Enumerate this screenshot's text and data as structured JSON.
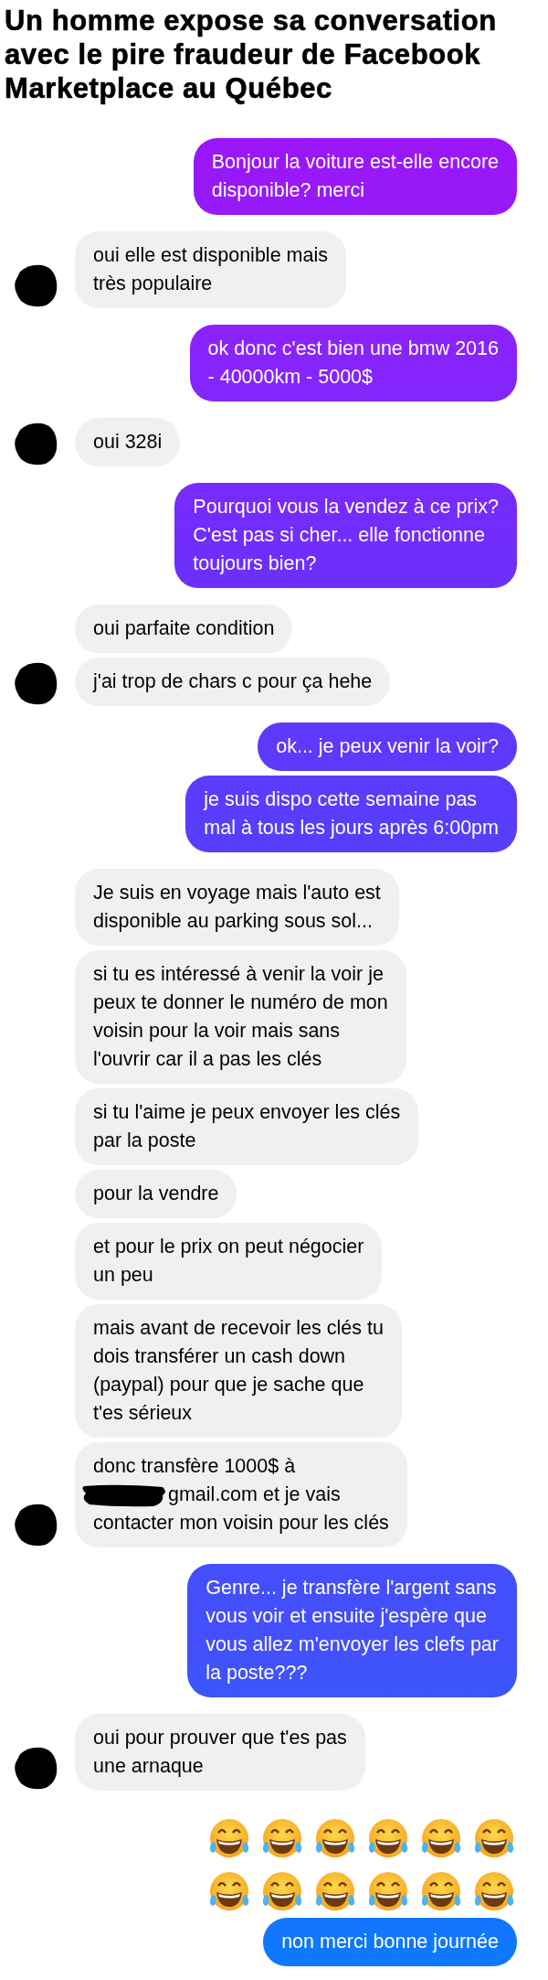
{
  "title": "Un homme expose sa conversation avec le pire fraudeur de Facebook Marketplace au Québec",
  "messages": [
    {
      "kind": "text",
      "outgoing": true,
      "lines": [
        "Bonjour la voiture est-elle encore",
        "disponible? merci"
      ]
    },
    {
      "kind": "text",
      "outgoing": false,
      "avatar": true,
      "lines": [
        "oui elle est disponible mais",
        "très populaire"
      ]
    },
    {
      "kind": "text",
      "outgoing": true,
      "lines": [
        "ok donc c'est bien une bmw 2016",
        "- 40000km - 5000$"
      ]
    },
    {
      "kind": "text",
      "outgoing": false,
      "avatar": true,
      "lines": [
        "oui 328i"
      ]
    },
    {
      "kind": "text",
      "outgoing": true,
      "lines": [
        "Pourquoi vous la vendez à ce prix?",
        "C'est pas si cher... elle fonctionne",
        "toujours bien?"
      ]
    },
    {
      "kind": "text",
      "outgoing": false,
      "avatar": false,
      "lines": [
        "oui parfaite condition"
      ]
    },
    {
      "kind": "text",
      "outgoing": false,
      "avatar": true,
      "lines": [
        "j'ai trop de chars c pour ça hehe"
      ]
    },
    {
      "kind": "text",
      "outgoing": true,
      "lines": [
        "ok... je peux venir la voir?"
      ]
    },
    {
      "kind": "text",
      "outgoing": true,
      "lines": [
        "je suis dispo cette semaine pas",
        "mal à tous les jours après 6:00pm"
      ]
    },
    {
      "kind": "text",
      "outgoing": false,
      "avatar": false,
      "lines": [
        "Je suis en voyage mais l'auto est",
        "disponible au parking sous sol..."
      ]
    },
    {
      "kind": "text",
      "outgoing": false,
      "avatar": false,
      "lines": [
        "si tu es intéressé à venir la voir je",
        "peux te donner le numéro de mon",
        "voisin pour la voir mais sans",
        "l'ouvrir car il a pas les clés"
      ]
    },
    {
      "kind": "text",
      "outgoing": false,
      "avatar": false,
      "lines": [
        "si tu l'aime je peux envoyer les clés",
        "par la poste"
      ]
    },
    {
      "kind": "text",
      "outgoing": false,
      "avatar": false,
      "lines": [
        "pour la vendre"
      ]
    },
    {
      "kind": "text",
      "outgoing": false,
      "avatar": false,
      "lines": [
        "et pour le prix on peut négocier",
        "un peu"
      ]
    },
    {
      "kind": "text",
      "outgoing": false,
      "avatar": false,
      "lines": [
        "mais avant de recevoir les clés tu",
        "dois transférer un cash down",
        "(paypal) pour que je sache que",
        "t'es sérieux"
      ]
    },
    {
      "kind": "redacted",
      "outgoing": false,
      "avatar": true,
      "before": "donc transfère 1000$ à",
      "after_lines": [
        "gmail.com et je vais",
        "contacter mon voisin pour les clés"
      ]
    },
    {
      "kind": "text",
      "outgoing": true,
      "lines": [
        "Genre... je transfère l'argent sans",
        "vous voir et ensuite j'espère que",
        "vous allez m'envoyer les clefs par",
        "la poste???"
      ]
    },
    {
      "kind": "text",
      "outgoing": false,
      "avatar": true,
      "lines": [
        "oui pour prouver que t'es pas",
        "une arnaque"
      ]
    },
    {
      "kind": "emoji",
      "outgoing": true,
      "rows": [
        {
          "faces": [
            {
              "kind": "tears_of_joy"
            },
            {
              "kind": "tears_of_joy"
            },
            {
              "kind": "tears_of_joy"
            },
            {
              "kind": "tears_of_joy"
            },
            {
              "kind": "tears_of_joy"
            },
            {
              "kind": "tears_of_joy"
            }
          ]
        },
        {
          "faces": [
            {
              "kind": "tears_of_joy"
            },
            {
              "kind": "tears_of_joy"
            },
            {
              "kind": "tears_of_joy"
            },
            {
              "kind": "tears_of_joy"
            },
            {
              "kind": "tears_of_joy"
            },
            {
              "kind": "tears_of_joy"
            }
          ]
        }
      ]
    },
    {
      "kind": "text",
      "outgoing": true,
      "lines": [
        "non merci bonne journée"
      ]
    }
  ]
}
